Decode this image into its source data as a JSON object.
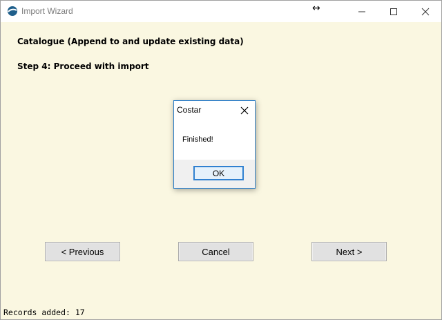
{
  "window": {
    "title": "Import Wizard",
    "resize_cursor_glyph": "↔",
    "app_icon": "app-logo-icon"
  },
  "content": {
    "heading": "Catalogue (Append to and update existing data)",
    "step": "Step 4: Proceed with import"
  },
  "buttons": {
    "previous": "< Previous",
    "cancel": "Cancel",
    "next": "Next >"
  },
  "status": {
    "text": "Records added: 17"
  },
  "dialog": {
    "title": "Costar",
    "message": "Finished!",
    "ok": "OK"
  },
  "colors": {
    "background": "#faf7e1",
    "dialog_border": "#2e7fc9",
    "ok_border": "#2f80d0"
  }
}
